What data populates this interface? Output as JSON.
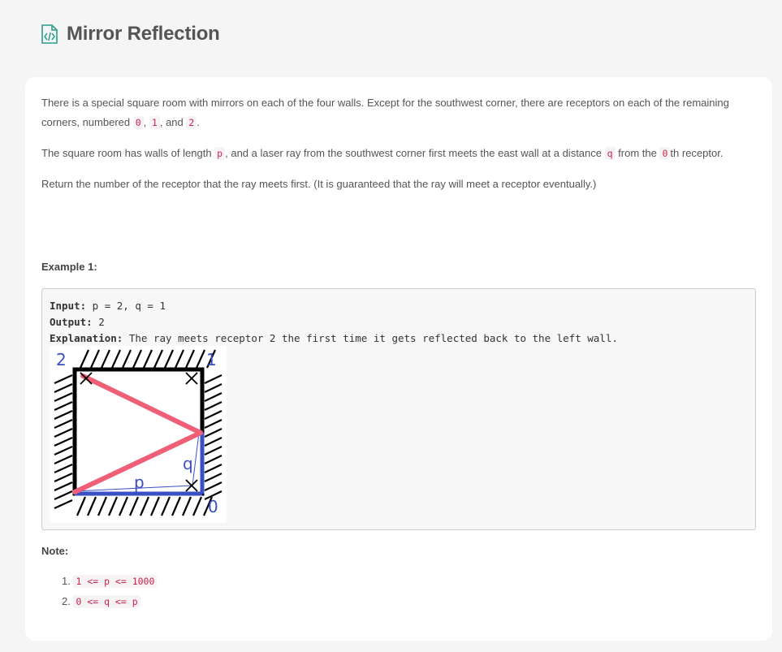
{
  "header": {
    "title": "Mirror Reflection",
    "icon": "code-file-icon"
  },
  "description": {
    "p1": {
      "text": "There is a special square room with mirrors on each of the four walls.  Except for the southwest corner, there are receptors on each of the remaining corners, numbered ",
      "c1": "0",
      "s1": ", ",
      "c2": "1",
      "s2": ", and ",
      "c3": "2",
      "s3": "."
    },
    "p2": {
      "t1": "The square room has walls of length ",
      "c1": "p",
      "t2": ", and a laser ray from the southwest corner first meets the east wall at a distance ",
      "c2": "q",
      "t3": " from the ",
      "c3": "0",
      "t4": "th receptor."
    },
    "p3": "Return the number of the receptor that the ray meets first.  (It is guaranteed that the ray will meet a receptor eventually.)"
  },
  "example": {
    "title": "Example 1:",
    "input_label": "Input:",
    "input_value": " p = 2, q = 1",
    "output_label": "Output:",
    "output_value": " 2",
    "explanation_label": "Explanation:",
    "explanation_value": " The ray meets receptor 2 the first time it gets reflected back to the left wall.",
    "diagram": {
      "label_2": "2",
      "label_1": "1",
      "label_0": "0",
      "label_p": "p",
      "label_q": "q"
    }
  },
  "note": {
    "title": "Note:",
    "items": [
      {
        "num": "1.",
        "code": "1 <= p <= 1000"
      },
      {
        "num": "2.",
        "code": "0 <= q <= p"
      }
    ]
  },
  "colors": {
    "ray": "#ef6078",
    "label": "#3b4fc4",
    "wall": "#000000",
    "code": "#c7254e"
  }
}
